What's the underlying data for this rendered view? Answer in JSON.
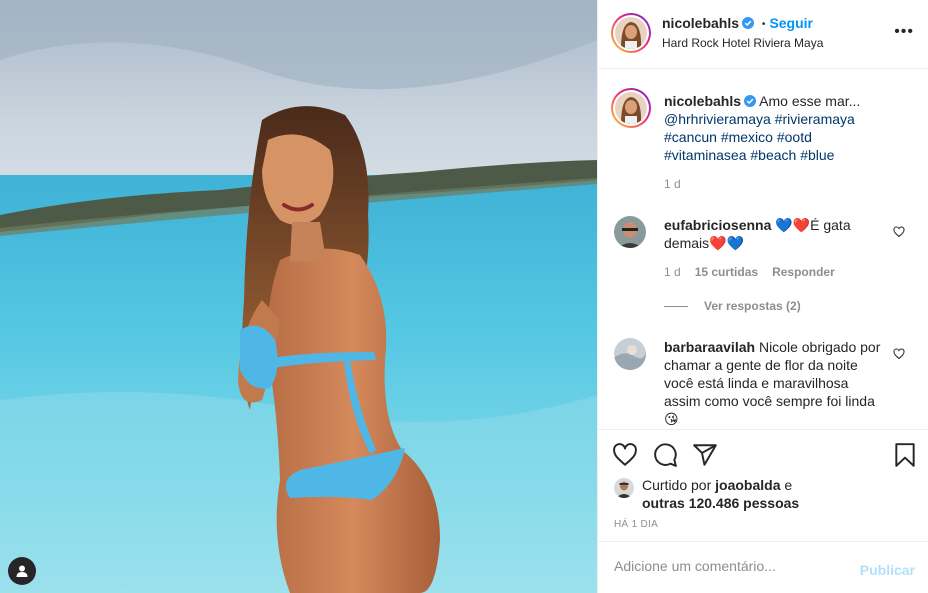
{
  "post": {
    "author": "nicolebahls",
    "follow_label": "Seguir",
    "separator": "•",
    "location": "Hard Rock Hotel Riviera Maya",
    "more_label": "•••"
  },
  "caption": {
    "author": "nicolebahls",
    "text": "Amo esse mar...",
    "tags_line1": "@hrhrivieramaya #rivieramaya",
    "tags_line2": "#cancun #mexico #ootd",
    "tags_line3": "#vitaminasea #beach #blue",
    "age": "1 d"
  },
  "comments": [
    {
      "author": "eufabriciosenna",
      "text": "💙❤️É gata demais❤️💙",
      "age": "1 d",
      "likes": "15 curtidas",
      "reply_label": "Responder",
      "view_replies": "Ver respostas (2)"
    },
    {
      "author": "barbaraavilah",
      "text": "Nicole obrigado por chamar a gente de flor da noite você está linda e maravilhosa assim como você sempre foi linda😘"
    }
  ],
  "likes": {
    "prefix": "Curtido por",
    "user": "joaobalda",
    "conj": "e",
    "others": "outras 120.486 pessoas"
  },
  "timestamp": "HÁ 1 DIA",
  "composer": {
    "placeholder": "Adicione um comentário...",
    "publish_label": "Publicar"
  },
  "icons": [
    "heart-icon",
    "comment-icon",
    "share-icon",
    "bookmark-icon",
    "verified-icon",
    "more-icon",
    "user-tag-icon"
  ],
  "colors": {
    "accent": "#0095f6",
    "hashtag": "#00376b",
    "muted": "#8e8e8e",
    "publish_disabled": "#b2dffc"
  }
}
